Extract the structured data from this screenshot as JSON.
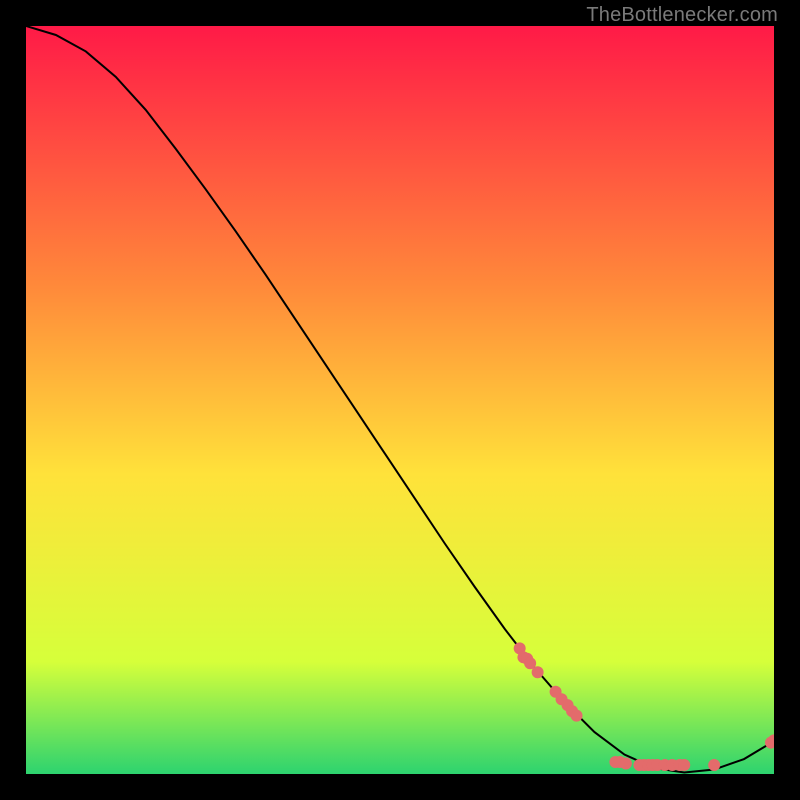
{
  "watermark": "TheBottlenecker.com",
  "chart_data": {
    "type": "line",
    "title": "",
    "xlabel": "",
    "ylabel": "",
    "xlim": [
      0,
      100
    ],
    "ylim": [
      0,
      100
    ],
    "grid": false,
    "legend": false,
    "background_gradient": {
      "top": "#ff1a47",
      "mid_upper": "#ff8a3a",
      "mid": "#ffe23a",
      "mid_lower": "#d6ff3a",
      "bottom": "#2dd36f"
    },
    "curve": [
      {
        "x": 0,
        "y": 100.0
      },
      {
        "x": 4,
        "y": 98.8
      },
      {
        "x": 8,
        "y": 96.6
      },
      {
        "x": 12,
        "y": 93.2
      },
      {
        "x": 16,
        "y": 88.8
      },
      {
        "x": 20,
        "y": 83.6
      },
      {
        "x": 24,
        "y": 78.2
      },
      {
        "x": 28,
        "y": 72.6
      },
      {
        "x": 32,
        "y": 66.8
      },
      {
        "x": 36,
        "y": 60.8
      },
      {
        "x": 40,
        "y": 54.8
      },
      {
        "x": 44,
        "y": 48.8
      },
      {
        "x": 48,
        "y": 42.8
      },
      {
        "x": 52,
        "y": 36.8
      },
      {
        "x": 56,
        "y": 30.8
      },
      {
        "x": 60,
        "y": 25.0
      },
      {
        "x": 64,
        "y": 19.4
      },
      {
        "x": 68,
        "y": 14.2
      },
      {
        "x": 72,
        "y": 9.6
      },
      {
        "x": 76,
        "y": 5.6
      },
      {
        "x": 80,
        "y": 2.6
      },
      {
        "x": 84,
        "y": 0.8
      },
      {
        "x": 88,
        "y": 0.2
      },
      {
        "x": 92,
        "y": 0.6
      },
      {
        "x": 96,
        "y": 2.0
      },
      {
        "x": 100,
        "y": 4.4
      }
    ],
    "scatter": [
      {
        "x": 66.0,
        "y": 16.8
      },
      {
        "x": 66.5,
        "y": 15.6
      },
      {
        "x": 67.0,
        "y": 15.4
      },
      {
        "x": 67.4,
        "y": 14.8
      },
      {
        "x": 68.4,
        "y": 13.6
      },
      {
        "x": 70.8,
        "y": 11.0
      },
      {
        "x": 71.6,
        "y": 10.0
      },
      {
        "x": 72.4,
        "y": 9.2
      },
      {
        "x": 73.0,
        "y": 8.4
      },
      {
        "x": 73.6,
        "y": 7.8
      },
      {
        "x": 78.8,
        "y": 1.6
      },
      {
        "x": 79.4,
        "y": 1.6
      },
      {
        "x": 80.2,
        "y": 1.4
      },
      {
        "x": 82.0,
        "y": 1.2
      },
      {
        "x": 82.6,
        "y": 1.2
      },
      {
        "x": 83.2,
        "y": 1.2
      },
      {
        "x": 83.8,
        "y": 1.2
      },
      {
        "x": 84.4,
        "y": 1.2
      },
      {
        "x": 85.4,
        "y": 1.2
      },
      {
        "x": 86.4,
        "y": 1.2
      },
      {
        "x": 87.4,
        "y": 1.2
      },
      {
        "x": 88.0,
        "y": 1.2
      },
      {
        "x": 92.0,
        "y": 1.2
      },
      {
        "x": 99.6,
        "y": 4.2
      },
      {
        "x": 100.0,
        "y": 4.5
      }
    ],
    "scatter_color": "#e36b6b",
    "curve_color": "#000000"
  }
}
